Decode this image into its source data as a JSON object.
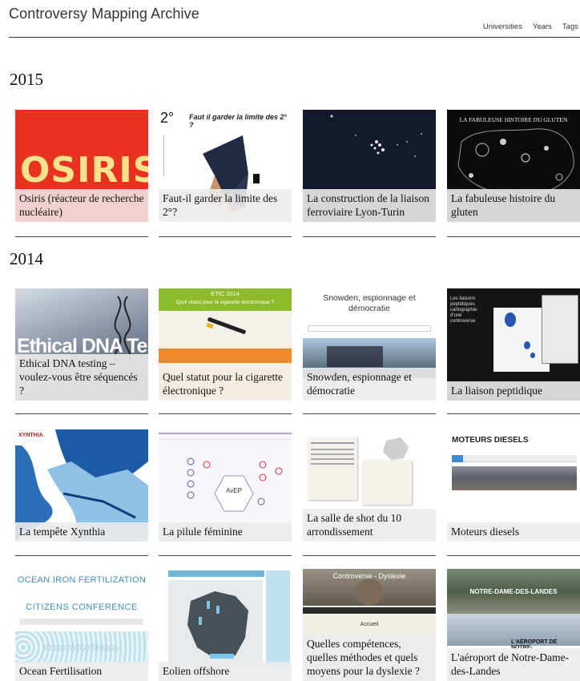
{
  "header": {
    "title": "Controversy Mapping Archive",
    "nav": [
      "Universities",
      "Years",
      "Tags"
    ]
  },
  "sections": [
    {
      "year": "2015",
      "cards": [
        {
          "title": "Osiris (réacteur de recherche nucléaire)",
          "thumb_text": "OSIRIS"
        },
        {
          "title": "Faut-il garder la limite des 2°?",
          "thumb_text": "Faut il garder la limite des 2° ?",
          "thumb_label": "2°"
        },
        {
          "title": "La construction de la liaison ferroviaire Lyon-Turin"
        },
        {
          "title": "La fabuleuse histoire du gluten",
          "thumb_text": "LA FABULEUSE HISTOIRE DU GLUTEN"
        }
      ]
    },
    {
      "year": "2014",
      "cards": [
        {
          "title": "Ethical DNA testing – voulez-vous être séquencés ?",
          "thumb_text": "Ethical DNA Testing"
        },
        {
          "title": "Quel statut pour la cigarette électronique ?",
          "thumb_text": "ETIC 2014",
          "thumb_sub": "Quel statut pour la cigarette électronique ?"
        },
        {
          "title": "Snowden, espionnage et démocratie",
          "thumb_text": "Snowden, espionnage et démocratie"
        },
        {
          "title": "La liaison peptidique",
          "thumb_text": "Les liaisons peptidiques cartographie d'une controverse"
        },
        {
          "title": "La tempête Xynthia",
          "thumb_text": "XYNTHIA"
        },
        {
          "title": "La pilule féminine",
          "thumb_text": "AvEP"
        },
        {
          "title": "La salle de shot du 10 arrondissement"
        },
        {
          "title": "Moteurs diesels",
          "thumb_text": "MOTEURS DIESELS"
        },
        {
          "title": "Ocean Fertilisation",
          "thumb_text": "OCEAN IRON FERTILIZATION",
          "thumb_sub": "CITIZENS CONFERENCE",
          "thumb_banner": "Welcome to the OIF Citizens"
        },
        {
          "title": "Eolien offshore"
        },
        {
          "title": "Quelles compétences, quelles méthodes et quels moyens pour la dyslexie ?",
          "thumb_text": "Controverse - Dyslexie",
          "thumb_sub": "Accueil"
        },
        {
          "title": "L'aéroport de Notre-Dame-des-Landes",
          "thumb_text": "NOTRE-DAME-DES-LANDES",
          "thumb_sub": "L'AÉROPORT DE NOTRE-"
        }
      ]
    }
  ],
  "colors": {
    "osiris_red": "#e8321f",
    "osiris_yellow": "#f7e38c",
    "rule": "#444444"
  }
}
